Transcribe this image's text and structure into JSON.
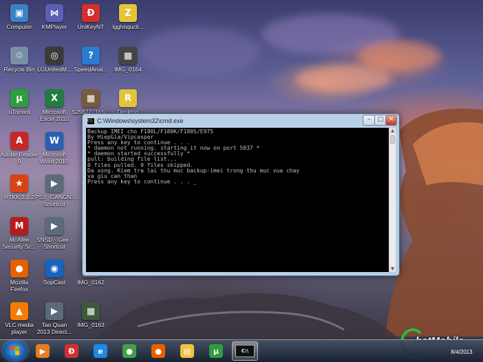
{
  "desktop": {
    "icons": [
      {
        "label": "Computer",
        "glyph": "▣",
        "color": "#3b82c4"
      },
      {
        "label": "KMPlayer",
        "glyph": "⋈",
        "color": "#5b5fb3"
      },
      {
        "label": "UniKeyNT",
        "glyph": "Đ",
        "color": "#d32f2f"
      },
      {
        "label": "lgghnqucli...",
        "glyph": "Z",
        "color": "#e5c33a"
      },
      {
        "label": "Recycle Bin",
        "glyph": "♲",
        "color": "#7a8fa6"
      },
      {
        "label": "LGUnitedM...",
        "glyph": "◎",
        "color": "#3a3a3a"
      },
      {
        "label": "SpeedAnal...",
        "glyph": "?",
        "color": "#2a7bd1"
      },
      {
        "label": "IMG_0164",
        "glyph": "▦",
        "color": "#444"
      },
      {
        "label": "uTorrent",
        "glyph": "µ",
        "color": "#2e9e3e"
      },
      {
        "label": "Microsoft\nExcel 2010",
        "glyph": "X",
        "color": "#1e7e3e"
      },
      {
        "label": "525677_165...",
        "glyph": "▦",
        "color": "#7a5c3a"
      },
      {
        "label": "Desktop",
        "glyph": "R",
        "color": "#e5c33a"
      },
      {
        "label": "Adobe Reader\n9",
        "glyph": "A",
        "color": "#c62828"
      },
      {
        "label": "Microsoft\nWord 2010",
        "glyph": "W",
        "color": "#2b5fb3"
      },
      {
        "label": "HTKK 3.1.2",
        "glyph": "★",
        "color": "#d84315"
      },
      {
        "label": "PSY_GANGN...\nShortcut",
        "glyph": "▶",
        "color": "#5c6b7a"
      },
      {
        "label": "McAfee\nSecurity Sc...",
        "glyph": "M",
        "color": "#b71c1c"
      },
      {
        "label": "SNSD - Gee -\nShortcut",
        "glyph": "▶",
        "color": "#5c6b7a"
      },
      {
        "label": "Mozilla\nFirefox",
        "glyph": "●",
        "color": "#e66000"
      },
      {
        "label": "SopCast",
        "glyph": "◉",
        "color": "#1565c0"
      },
      {
        "label": "IMG_0162",
        "glyph": "▦",
        "color": "#6b6b6b"
      },
      {
        "label": "VLC media\nplayer",
        "glyph": "▲",
        "color": "#f57c00"
      },
      {
        "label": "Tao Quan\n2013 Direct...",
        "glyph": "▶",
        "color": "#5c6b7a"
      },
      {
        "label": "IMG_0163",
        "glyph": "▦",
        "color": "#3f5a3a"
      }
    ]
  },
  "cmd": {
    "title": "C:\\Windows\\system32\\cmd.exe",
    "output": "Backup IMEI cho F180L/F180K/F180S/E975\nBy HiepGia/Vipcasper\nPress any key to continue . . .\n* daemon not running. starting it now on port 5037 *\n* daemon started successfully *\npull: building file list...\n0 files pulled. 0 files skipped.\nDa xong. Kiem tra lai thu muc backup-imei trong thu muc vua chay\nva giu can than\nPress any key to continue . . . _",
    "minimize": "–",
    "maximize": "□",
    "close": "✕"
  },
  "taskbar": {
    "buttons": [
      {
        "name": "media-player",
        "glyph": "▶",
        "color": "#e67e22"
      },
      {
        "name": "unikey",
        "glyph": "Đ",
        "color": "#d32f2f"
      },
      {
        "name": "internet-explorer",
        "glyph": "e",
        "color": "#1e88e5"
      },
      {
        "name": "chrome",
        "glyph": "●",
        "color": "#43a047"
      },
      {
        "name": "firefox",
        "glyph": "●",
        "color": "#e66000"
      },
      {
        "name": "file-explorer",
        "glyph": "▤",
        "color": "#f0c040"
      },
      {
        "name": "utorrent",
        "glyph": "µ",
        "color": "#2e9e3e"
      },
      {
        "name": "cmd",
        "glyph": "C:\\",
        "color": "#111111"
      }
    ],
    "clock_date": "8/4/2013"
  }
}
